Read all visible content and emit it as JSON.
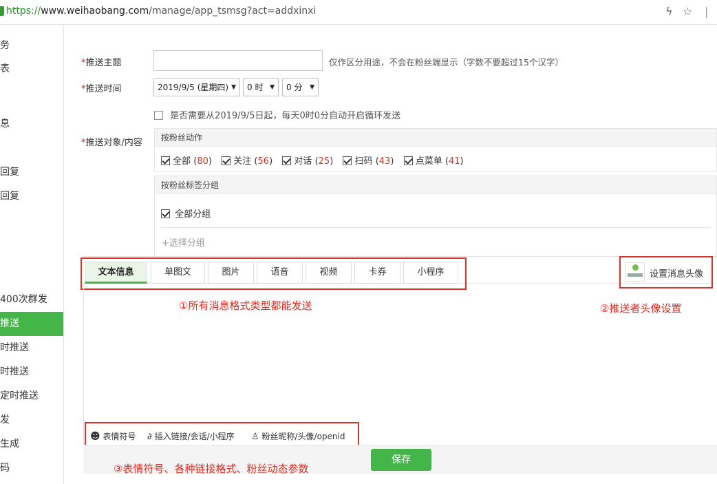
{
  "address_bar": {
    "scheme": "https://",
    "host": "www.weihaobang.com",
    "path": "/manage/app_tsmsg?act=addxinxi"
  },
  "sidebar": {
    "items": [
      {
        "label": "务",
        "active": false
      },
      {
        "label": "表",
        "active": false
      },
      {
        "label": "息",
        "active": false
      },
      {
        "label": "回复",
        "active": false
      },
      {
        "label": "回复",
        "active": false
      },
      {
        "label": "400次群发",
        "active": false
      },
      {
        "label": "推送",
        "active": true
      },
      {
        "label": "时推送",
        "active": false
      },
      {
        "label": "时推送",
        "active": false
      },
      {
        "label": "定时推送",
        "active": false
      },
      {
        "label": "发",
        "active": false
      },
      {
        "label": "生成",
        "active": false
      },
      {
        "label": "码",
        "active": false
      }
    ]
  },
  "form": {
    "subject": {
      "required_mark": "*",
      "label": "推送主题",
      "value": "",
      "hint": "仅作区分用途，不会在粉丝端显示（字数不要超过15个汉字）"
    },
    "time": {
      "required_mark": "*",
      "label": "推送时间",
      "date": "2019/9/5 (星期四)",
      "hour": "0 时",
      "minute": "0 分"
    },
    "loop": {
      "checked": false,
      "label": "是否需要从2019/9/5日起，每天0时0分自动开启循环发送"
    },
    "target": {
      "required_mark": "*",
      "label": "推送对象/内容",
      "actions_header": "按粉丝动作",
      "actions": [
        {
          "label": "全部",
          "count": "80",
          "checked": true
        },
        {
          "label": "关注",
          "count": "56",
          "checked": true
        },
        {
          "label": "对话",
          "count": "25",
          "checked": true
        },
        {
          "label": "扫码",
          "count": "43",
          "checked": true
        },
        {
          "label": "点菜单",
          "count": "41",
          "checked": true
        }
      ],
      "tags_header": "按粉丝标签分组",
      "all_groups_label": "全部分组",
      "all_groups_checked": true,
      "choose_group": "+选择分组"
    }
  },
  "message_tabs": [
    {
      "label": "文本信息",
      "active": true
    },
    {
      "label": "单图文",
      "active": false
    },
    {
      "label": "图片",
      "active": false
    },
    {
      "label": "语音",
      "active": false
    },
    {
      "label": "视频",
      "active": false
    },
    {
      "label": "卡券",
      "active": false
    },
    {
      "label": "小程序",
      "active": false
    }
  ],
  "avatar_setting": {
    "label": "设置消息头像"
  },
  "annotations": {
    "a1": "①所有消息格式类型都能发送",
    "a2": "②推送者头像设置",
    "a3": "③表情符号、各种链接格式、粉丝动态参数"
  },
  "editor_toolbar": {
    "emoji": "表情符号",
    "link": "插入链接/会话/小程序",
    "fan": "粉丝昵称/头像/openid"
  },
  "save_label": "保存",
  "colors": {
    "accent": "#44b549",
    "annotation": "#e02b20",
    "count": "#c0392b"
  }
}
